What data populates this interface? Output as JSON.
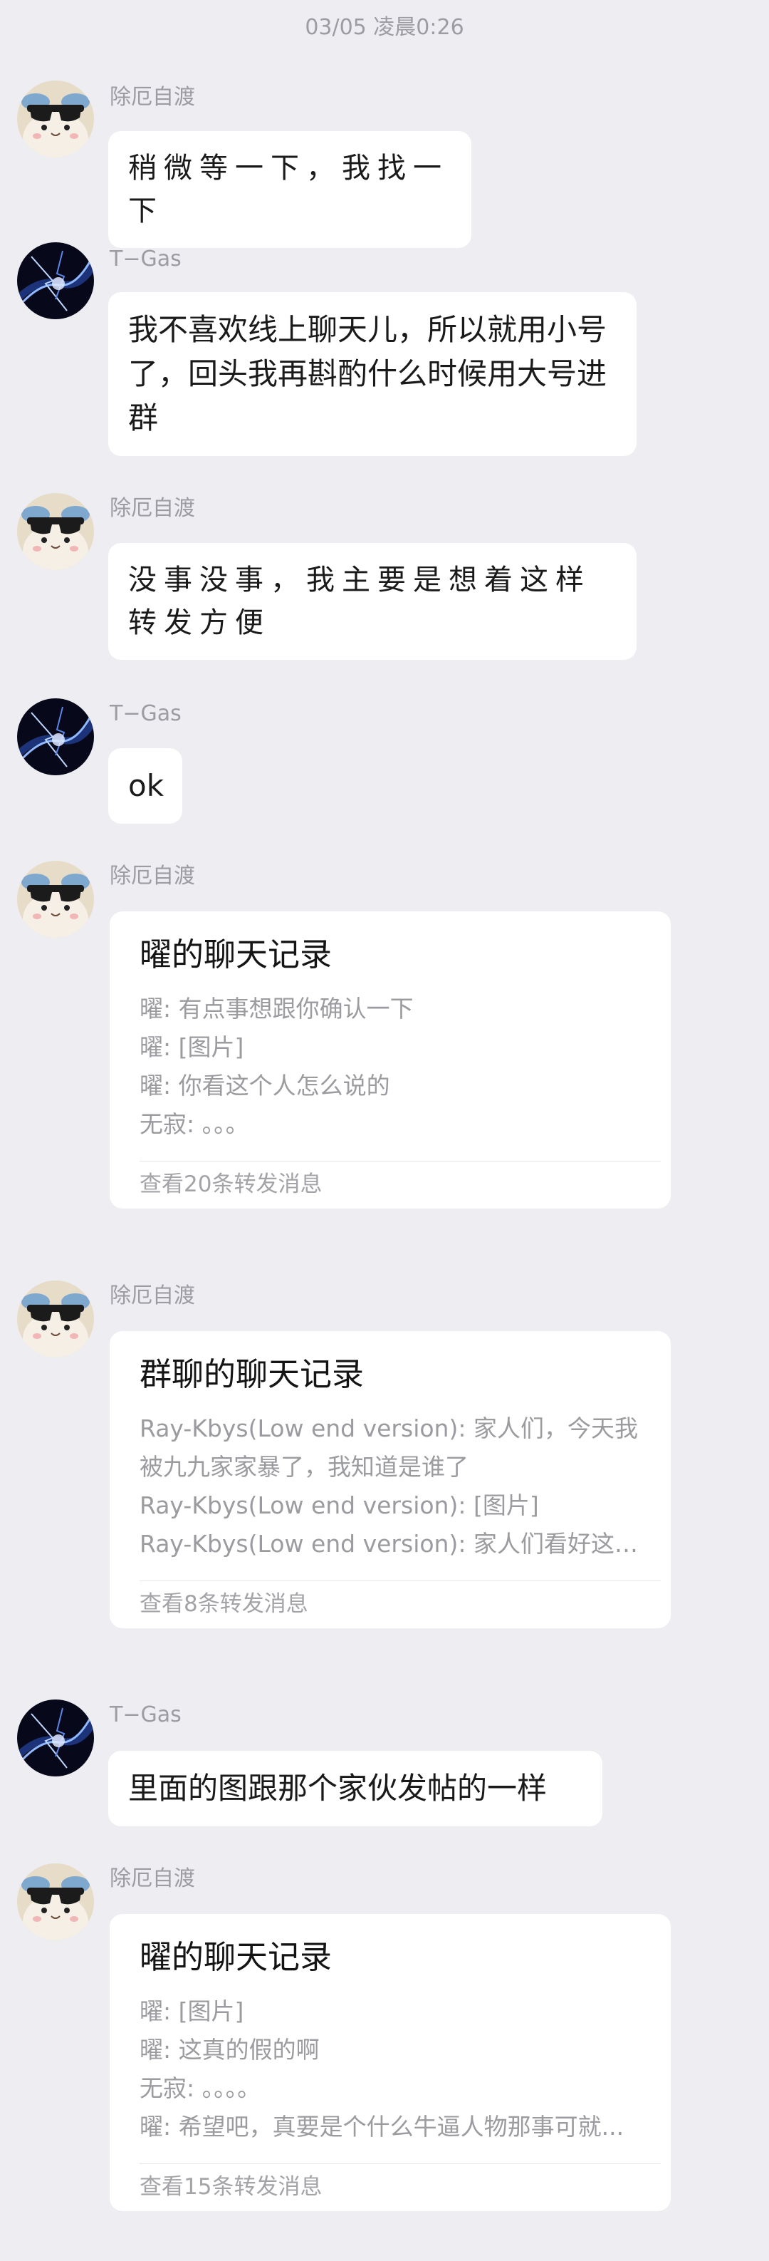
{
  "timestamp": "03/05 凌晨0:26",
  "users": {
    "a": {
      "name": "除厄自渡",
      "avatar_icon": "hamster-sunglasses-avatar"
    },
    "b": {
      "name": "T−Gas",
      "avatar_icon": "blue-lightning-avatar"
    }
  },
  "messages": [
    {
      "sender": "除厄自渡",
      "text": "稍微等一下，我找一下"
    },
    {
      "sender": "T−Gas",
      "text": "我不喜欢线上聊天儿，所以就用小号了，回头我再斟酌什么时候用大号进群"
    },
    {
      "sender": "除厄自渡",
      "text": "没事没事，我主要是想着这样转发方便"
    },
    {
      "sender": "T−Gas",
      "text": "ok"
    },
    {
      "sender": "除厄自渡",
      "card": {
        "title": "曜的聊天记录",
        "lines": [
          "曜: 有点事想跟你确认一下",
          "曜: [图片]",
          "曜: 你看这个人怎么说的",
          "无寂: 。。。"
        ],
        "footer": "查看20条转发消息"
      }
    },
    {
      "sender": "除厄自渡",
      "card": {
        "title": "群聊的聊天记录",
        "lines": [
          "Ray-Kbys(Low end version): 家人们，今天我被九九家家暴了，我知道是谁了",
          "Ray-Kbys(Low end version): [图片]",
          "Ray-Kbys(Low end version): 家人们看好这两..."
        ],
        "footer": "查看8条转发消息"
      }
    },
    {
      "sender": "T−Gas",
      "text": "里面的图跟那个家伙发帖的一样"
    },
    {
      "sender": "除厄自渡",
      "card": {
        "title": "曜的聊天记录",
        "lines": [
          "曜: [图片]",
          "曜: 这真的假的啊",
          "无寂: 。。。。",
          "曜: 希望吧，真要是个什么牛逼人物那事可就..."
        ],
        "footer": "查看15条转发消息"
      }
    }
  ]
}
